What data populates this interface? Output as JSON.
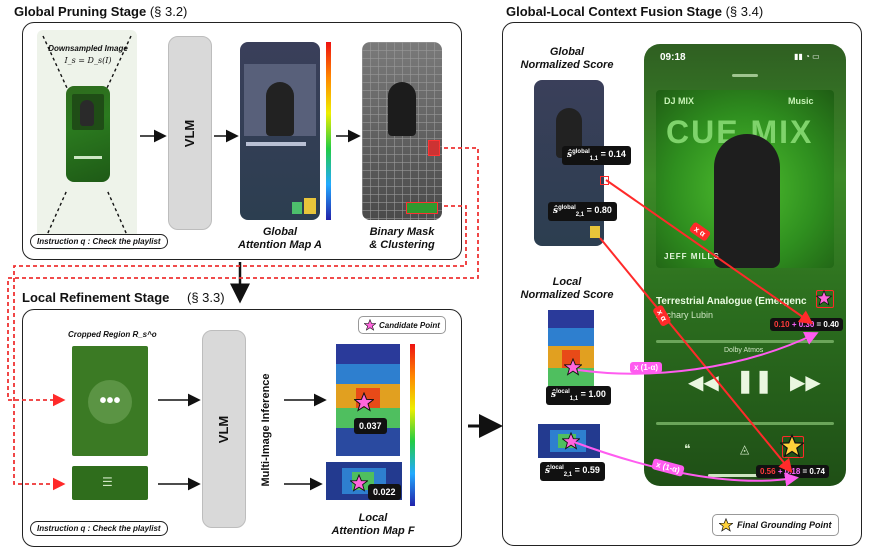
{
  "global_stage": {
    "title": "Global Pruning Stage",
    "section": "(§ 3.2)",
    "downsampled_label": "Downsampled Image",
    "downsampled_formula": "I_s = D_s(I)",
    "vlm_label": "VLM",
    "attention_caption_line1": "Global",
    "attention_caption_line2": "Attention Map A",
    "mask_caption_line1": "Binary Mask",
    "mask_caption_line2": "& Clustering",
    "instruction": "Instruction q : Check the playlist"
  },
  "local_stage": {
    "title": "Local Refinement Stage",
    "section": "(§ 3.3)",
    "cropped_label": "Cropped Region R_s^o",
    "vlm_label": "VLM",
    "multi_image_label": "Multi-Image Inference",
    "candidate_legend": "Candidate Point",
    "score_1": "0.037",
    "score_2": "0.022",
    "attention_caption_line1": "Local",
    "attention_caption_line2": "Attention Map F",
    "instruction": "Instruction q : Check the playlist"
  },
  "fusion_stage": {
    "title": "Global-Local Context Fusion Stage",
    "section": "(§ 3.4)",
    "global_score_label_line1": "Global",
    "global_score_label_line2": "Normalized Score",
    "local_score_label_line1": "Local",
    "local_score_label_line2": "Normalized Score",
    "global_score_1": "= 0.14",
    "global_score_2": "= 0.80",
    "local_score_1": "= 1.00",
    "local_score_2": "= 0.59",
    "sum_1_a": "0.10",
    "sum_1_b": "+ 0.30",
    "sum_1_c": "= 0.40",
    "sum_2_a": "0.56",
    "sum_2_b": "+ 0.18",
    "sum_2_c": "= 0.74",
    "alpha_label": "x α",
    "one_minus_alpha_label": "x (1-α)",
    "final_legend": "Final Grounding Point"
  },
  "phone": {
    "time": "09:18",
    "dj_mix": "DJ MIX",
    "apple_music": "Music",
    "artist_banner": "JEFF MILLS",
    "track_title": "Terrestrial Analogue (Emergenc",
    "track_artist": "Zachary Lubin",
    "dolby": "Dolby Atmos",
    "big_text": "CUE MIX"
  },
  "colors": {
    "red": "#ff2a2a",
    "pink": "#ff5cf0",
    "green_ui": "#2f7d1f",
    "star_pink": "#ff66dd",
    "star_gold": "#ffd23a"
  }
}
